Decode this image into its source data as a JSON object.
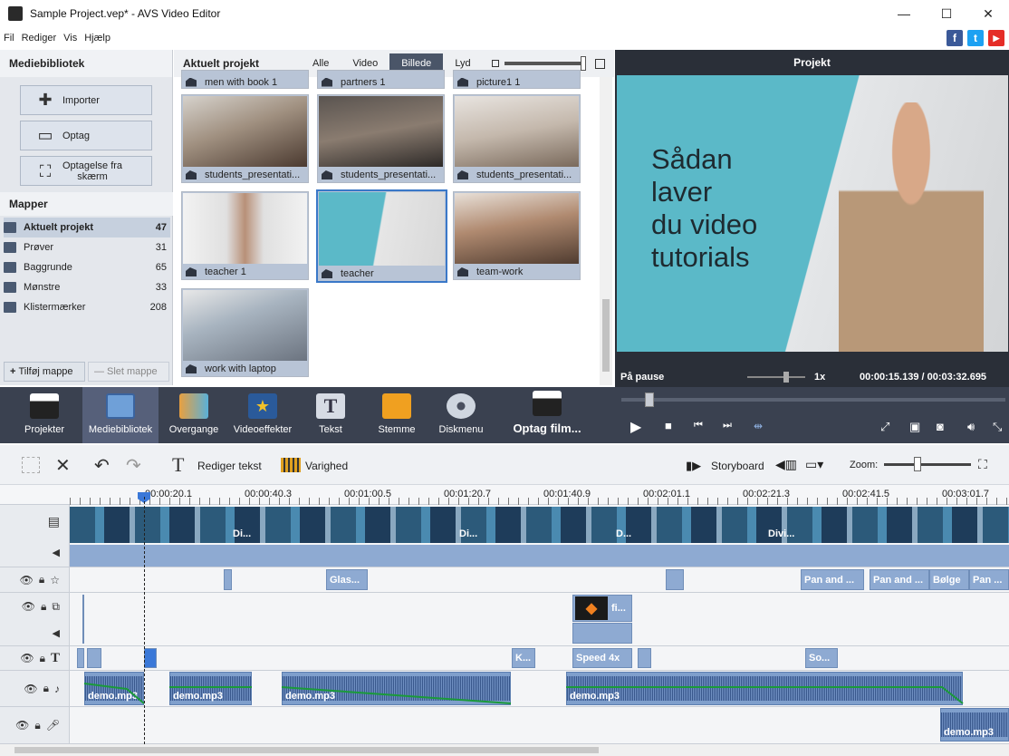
{
  "window": {
    "title": "Sample Project.vep* - AVS Video Editor",
    "minimize": "—",
    "maximize": "☐",
    "close": "✕"
  },
  "menu": [
    "Fil",
    "Rediger",
    "Vis",
    "Hjælp"
  ],
  "social": {
    "facebook": "f",
    "twitter": "t",
    "youtube": "▶"
  },
  "left": {
    "title": "Mediebibliotek",
    "buttons": {
      "import": "Importer",
      "record": "Optag",
      "screen_line1": "Optagelse fra",
      "screen_line2": "skærm"
    },
    "folders_title": "Mapper",
    "folders": [
      {
        "name": "Aktuelt projekt",
        "count": "47"
      },
      {
        "name": "Prøver",
        "count": "31"
      },
      {
        "name": "Baggrunde",
        "count": "65"
      },
      {
        "name": "Mønstre",
        "count": "33"
      },
      {
        "name": "Klistermærker",
        "count": "208"
      }
    ],
    "add_folder": "Tilføj mappe",
    "delete_folder": "Slet mappe"
  },
  "media": {
    "title": "Aktuelt projekt",
    "filters": [
      "Alle",
      "Video",
      "Billede",
      "Lyd"
    ],
    "active_filter": "Billede",
    "items": [
      "men with book 1",
      "partners 1",
      "picture1 1",
      "students_presentati...",
      "students_presentati...",
      "students_presentati...",
      "teacher 1",
      "teacher",
      "team-work",
      "work with laptop"
    ],
    "selected": "teacher"
  },
  "preview": {
    "title": "Projekt",
    "overlay": [
      "Sådan",
      "laver",
      "du video",
      "tutorials"
    ],
    "status": "På pause",
    "speed": "1x",
    "time": "00:00:15.139 / 00:03:32.695"
  },
  "tools": [
    "Projekter",
    "Mediebibliotek",
    "Overgange",
    "Videoeffekter",
    "Tekst",
    "Stemme",
    "Diskmenu",
    "Optag film..."
  ],
  "active_tool": "Mediebibliotek",
  "timeline": {
    "edit_text": "Rediger tekst",
    "duration": "Varighed",
    "storyboard": "Storyboard",
    "zoom": "Zoom:",
    "ruler": [
      "00:00:20.1",
      "00:00:40.3",
      "00:01:00.5",
      "00:01:20.7",
      "00:01:40.9",
      "00:02:01.1",
      "00:02:21.3",
      "00:02:41.5",
      "00:03:01.7"
    ],
    "video_labels": [
      "Di...",
      "Di...",
      "D...",
      "Divi..."
    ],
    "effects": [
      "Glas...",
      "Pan and ...",
      "Pan and ...",
      "Bølge",
      "Pan ..."
    ],
    "overlay_clip": "fi...",
    "texts": [
      "K...",
      "Speed 4x",
      "So..."
    ],
    "audio": [
      "demo.mp3",
      "demo.mp3",
      "demo.mp3",
      "demo.mp3"
    ],
    "voice": "demo.mp3"
  }
}
